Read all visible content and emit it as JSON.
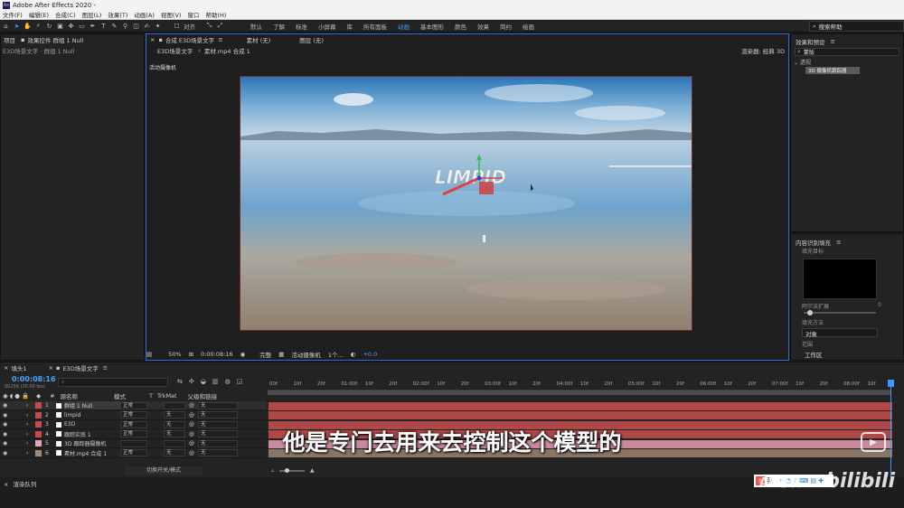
{
  "app": {
    "title": "Adobe After Effects 2020 -"
  },
  "menu": [
    "文件(F)",
    "编辑(E)",
    "合成(C)",
    "图层(L)",
    "效果(T)",
    "动画(A)",
    "视图(V)",
    "窗口",
    "帮助(H)"
  ],
  "toolbar": {
    "snap_label": "对齐"
  },
  "workspaces": [
    "默认",
    "了解",
    "标准",
    "小屏幕",
    "库",
    "所有面板",
    "动画",
    "基本图形",
    "颜色",
    "效果",
    "简约",
    "绘画"
  ],
  "search_help": "搜索帮助",
  "left_panel": {
    "tab1": "项目",
    "tab2": "效果控件 群组 1 Null",
    "subtitle": "E3D场景文字 · 群组 1 Null"
  },
  "comp_panel": {
    "tab": "合成 E3D场景文字",
    "footage_tab": "素材 (无)",
    "layer_tab": "图层 (无)",
    "subtab1": "E3D场景文字",
    "subtab2": "素材.mp4 合成 1",
    "renderer": "渲染器: 经典 3D",
    "camera_label": "活动摄像机",
    "viewer_text": "LIMPID"
  },
  "viewer_bar": {
    "zoom": "50%",
    "timecode": "0:00:08:16",
    "quality": "完整",
    "camera": "活动摄像机",
    "views": "1个...",
    "exposure": "+0.0"
  },
  "effects_panel": {
    "title": "效果和预设",
    "search": "蒙版",
    "category": "透视",
    "item": "3D 摄像机跟踪器"
  },
  "content_fill": {
    "title": "内容识别填充",
    "fill_target": "填充目标",
    "alpha_expand": "阿尔法扩展",
    "alpha_value": "0",
    "fill_method": "填充方法",
    "method_value": "对象",
    "range": "范围",
    "range_value": "工作区"
  },
  "timeline": {
    "tab1": "填头1",
    "tab2": "E3D场景文字",
    "timecode": "0:00:08:16",
    "frames": "00256 (30.00 fps)",
    "search_placeholder": "",
    "columns": {
      "num": "#",
      "name": "源名称",
      "mode": "模式",
      "t": "T",
      "trkmat": "TrkMat",
      "parent": "父级和链接"
    },
    "switch_mode": "切换开关/模式",
    "ruler": [
      "00f",
      "10f",
      "20f",
      "01:00f",
      "10f",
      "20f",
      "02:00f",
      "10f",
      "20f",
      "03:00f",
      "10f",
      "20f",
      "04:00f",
      "10f",
      "20f",
      "05:00f",
      "10f",
      "20f",
      "06:00f",
      "10f",
      "20f",
      "07:00f",
      "10f",
      "20f",
      "08:00f",
      "10f"
    ],
    "layers": [
      {
        "num": "1",
        "name": "群组 1 Null",
        "mode": "正常",
        "trkmat": "",
        "parent": "无",
        "color": "#c84b4b"
      },
      {
        "num": "2",
        "name": "limpid",
        "mode": "正常",
        "trkmat": "无",
        "parent": "无",
        "color": "#c84b4b"
      },
      {
        "num": "3",
        "name": "E3D",
        "mode": "正常",
        "trkmat": "无",
        "parent": "无",
        "color": "#c84b4b"
      },
      {
        "num": "4",
        "name": "跟踪实底 1",
        "mode": "正常",
        "trkmat": "无",
        "parent": "无",
        "color": "#c84b4b"
      },
      {
        "num": "5",
        "name": "3D 跟踪器摄像机",
        "mode": "",
        "trkmat": "",
        "parent": "无",
        "color": "#e4a6b4"
      },
      {
        "num": "6",
        "name": "素材.mp4 合成 1",
        "mode": "正常",
        "trkmat": "无",
        "parent": "无",
        "color": "#a08a7a"
      }
    ]
  },
  "bottom": {
    "render_queue": "渲染队列"
  },
  "overlay": {
    "subtitle": "他是专门去用来去控制这个模型的",
    "watermark": "AE老浪",
    "brand": "bilibili",
    "ime": "英"
  },
  "colors": {
    "accent": "#3a9bff",
    "layer_bar": "#b04848",
    "comp_border": "#2d6bd8"
  }
}
